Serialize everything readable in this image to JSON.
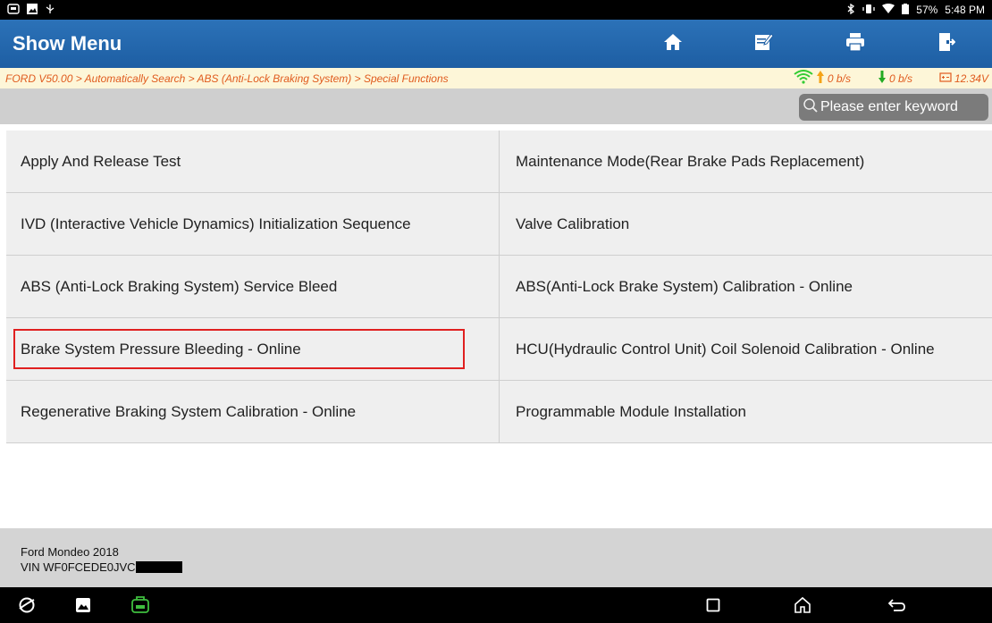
{
  "status_bar": {
    "battery": "57%",
    "time": "5:48 PM"
  },
  "header": {
    "title": "Show Menu",
    "buttons": [
      "home-icon",
      "edit-icon",
      "print-icon",
      "exit-icon"
    ]
  },
  "breadcrumb": {
    "path": "FORD V50.00 > Automatically Search > ABS (Anti-Lock Braking System) > Special Functions",
    "upload_rate": "0 b/s",
    "download_rate": "0 b/s",
    "voltage": "12.34V"
  },
  "search": {
    "placeholder": "Please enter keyword"
  },
  "menu": {
    "items": [
      "Apply And Release Test",
      "Maintenance Mode(Rear Brake Pads Replacement)",
      "IVD (Interactive Vehicle Dynamics) Initialization Sequence",
      "Valve Calibration",
      "ABS (Anti-Lock Braking System) Service Bleed",
      "ABS(Anti-Lock Brake System) Calibration - Online",
      "Brake System Pressure Bleeding - Online",
      "HCU(Hydraulic Control Unit) Coil Solenoid Calibration - Online",
      "Regenerative Braking System Calibration - Online",
      "Programmable Module Installation"
    ],
    "highlighted_index": 6
  },
  "vehicle": {
    "model": "Ford Mondeo 2018",
    "vin": "VIN WF0FCEDE0JVC"
  },
  "colors": {
    "header_bg": "#2266ad",
    "breadcrumb_text": "#e05b1e",
    "highlight_border": "#e02020",
    "vci_green": "#3fbf3f"
  }
}
